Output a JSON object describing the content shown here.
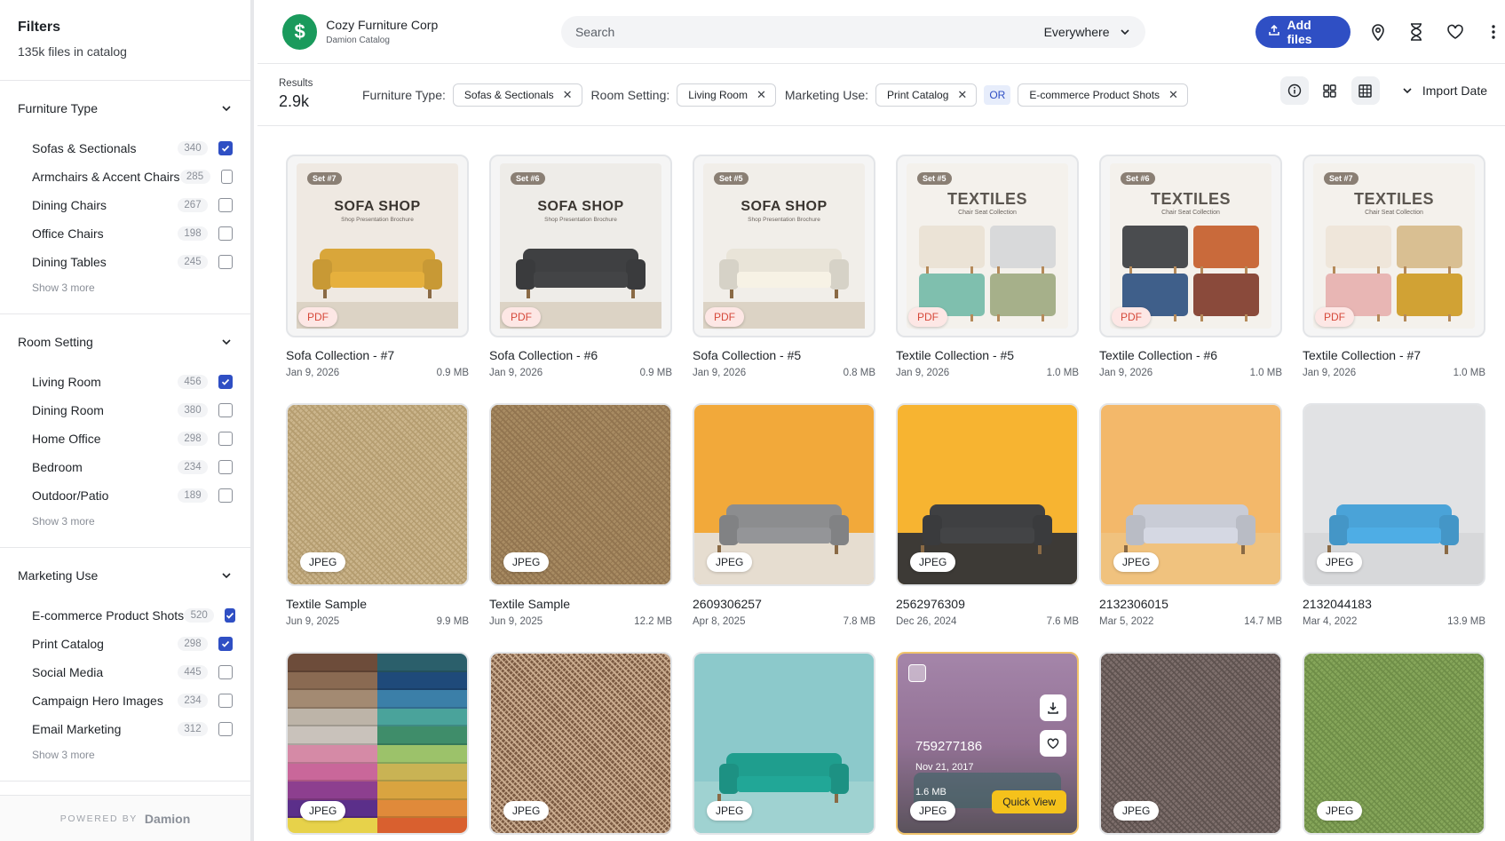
{
  "sidebar": {
    "title": "Filters",
    "subtitle": "135k files in catalog",
    "groups": [
      {
        "title": "Furniture Type",
        "show_more": "Show 3 more",
        "items": [
          {
            "label": "Sofas & Sectionals",
            "count": "340",
            "checked": true
          },
          {
            "label": "Armchairs & Accent Chairs",
            "count": "285",
            "checked": false
          },
          {
            "label": "Dining Chairs",
            "count": "267",
            "checked": false
          },
          {
            "label": "Office Chairs",
            "count": "198",
            "checked": false
          },
          {
            "label": "Dining Tables",
            "count": "245",
            "checked": false
          }
        ]
      },
      {
        "title": "Room Setting",
        "show_more": "Show 3 more",
        "items": [
          {
            "label": "Living Room",
            "count": "456",
            "checked": true
          },
          {
            "label": "Dining Room",
            "count": "380",
            "checked": false
          },
          {
            "label": "Home Office",
            "count": "298",
            "checked": false
          },
          {
            "label": "Bedroom",
            "count": "234",
            "checked": false
          },
          {
            "label": "Outdoor/Patio",
            "count": "189",
            "checked": false
          }
        ]
      },
      {
        "title": "Marketing Use",
        "show_more": "Show 3 more",
        "items": [
          {
            "label": "E-commerce Product Shots",
            "count": "520",
            "checked": true
          },
          {
            "label": "Print Catalog",
            "count": "298",
            "checked": true
          },
          {
            "label": "Social Media",
            "count": "445",
            "checked": false
          },
          {
            "label": "Campaign Hero Images",
            "count": "234",
            "checked": false
          },
          {
            "label": "Email Marketing",
            "count": "312",
            "checked": false
          }
        ]
      }
    ],
    "powered_by": "POWERED BY",
    "powered_brand": "Damion"
  },
  "topbar": {
    "org_name": "Cozy Furniture Corp",
    "org_sub": "Damion Catalog",
    "search_placeholder": "Search",
    "scope": "Everywhere",
    "add_files": "Add files"
  },
  "filterbar": {
    "results_label": "Results",
    "results_value": "2.9k",
    "furniture_label": "Furniture Type:",
    "furniture_chip": "Sofas & Sectionals",
    "room_label": "Room Setting:",
    "room_chip": "Living Room",
    "marketing_label": "Marketing Use:",
    "marketing_chip_1": "Print Catalog",
    "or_label": "OR",
    "marketing_chip_2": "E-commerce Product Shots",
    "sort_label": "Import Date"
  },
  "cards": [
    {
      "title": "Sofa Collection - #7",
      "date": "Jan 9, 2026",
      "size": "0.9 MB",
      "type": "PDF",
      "set": "Set #7",
      "poster": "SOFA SHOP",
      "poster_sub": "Shop Presentation Brochure",
      "kind": "sofa",
      "sofa": "#d9a63a",
      "bg": "#efe9e2"
    },
    {
      "title": "Sofa Collection - #6",
      "date": "Jan 9, 2026",
      "size": "0.9 MB",
      "type": "PDF",
      "set": "Set #6",
      "poster": "SOFA SHOP",
      "poster_sub": "Shop Presentation Brochure",
      "kind": "sofa",
      "sofa": "#3f4042",
      "bg": "#eeece8"
    },
    {
      "title": "Sofa Collection - #5",
      "date": "Jan 9, 2026",
      "size": "0.8 MB",
      "type": "PDF",
      "set": "Set #5",
      "poster": "SOFA SHOP",
      "poster_sub": "Shop Presentation Brochure",
      "kind": "sofa",
      "sofa": "#e9e4d8",
      "bg": "#f1eee9"
    },
    {
      "title": "Textile Collection - #5",
      "date": "Jan 9, 2026",
      "size": "1.0 MB",
      "type": "PDF",
      "set": "Set #5",
      "poster": "TEXTILES",
      "poster_sub": "Chair Seat Collection",
      "kind": "tex",
      "swatches": [
        "#ebe3d6",
        "#d8d9da",
        "#7fbfae",
        "#a6b08a"
      ]
    },
    {
      "title": "Textile Collection - #6",
      "date": "Jan 9, 2026",
      "size": "1.0 MB",
      "type": "PDF",
      "set": "Set #6",
      "poster": "TEXTILES",
      "poster_sub": "Chair Seat Collection",
      "kind": "tex",
      "swatches": [
        "#4a4c4f",
        "#c96a3b",
        "#3f5f8a",
        "#8a4a3b"
      ]
    },
    {
      "title": "Textile Collection - #7",
      "date": "Jan 9, 2026",
      "size": "1.0 MB",
      "type": "PDF",
      "set": "Set #7",
      "poster": "TEXTILES",
      "poster_sub": "Chair Seat Collection",
      "kind": "tex",
      "swatches": [
        "#efe6da",
        "#d9bf92",
        "#e8b6b4",
        "#d1a234"
      ]
    },
    {
      "title": "Textile Sample",
      "date": "Jun 9, 2025",
      "size": "9.9 MB",
      "type": "JPEG",
      "kind": "fabric",
      "bg": "#cbb58c",
      "stripe": "#b59d70"
    },
    {
      "title": "Textile Sample",
      "date": "Jun 9, 2025",
      "size": "12.2 MB",
      "type": "JPEG",
      "kind": "fabric",
      "bg": "#a88b62",
      "stripe": "#927550"
    },
    {
      "title": "2609306257",
      "date": "Apr 8, 2025",
      "size": "7.8 MB",
      "type": "JPEG",
      "kind": "room",
      "bg": "#f2a93a",
      "floor": "#e6ddd0",
      "sofa": "#8c8d8f"
    },
    {
      "title": "2562976309",
      "date": "Dec 26, 2024",
      "size": "7.6 MB",
      "type": "JPEG",
      "kind": "room",
      "bg": "#f7b431",
      "floor": "#3d3a36",
      "sofa": "#3f4042"
    },
    {
      "title": "2132306015",
      "date": "Mar 5, 2022",
      "size": "14.7 MB",
      "type": "JPEG",
      "kind": "room",
      "bg": "#f3b86a",
      "floor": "#f0c27e",
      "sofa": "#c9ccd6"
    },
    {
      "title": "2132044183",
      "date": "Mar 4, 2022",
      "size": "13.9 MB",
      "type": "JPEG",
      "kind": "room",
      "bg": "#e1e2e4",
      "floor": "#d7d8da",
      "sofa": "#4aa3d8"
    },
    {
      "title": "",
      "date": "",
      "size": "",
      "type": "JPEG",
      "kind": "stack"
    },
    {
      "title": "",
      "date": "",
      "size": "",
      "type": "JPEG",
      "kind": "fabric",
      "bg": "#7b5a42",
      "stripe": "#c9ab8e"
    },
    {
      "title": "",
      "date": "",
      "size": "",
      "type": "JPEG",
      "kind": "room",
      "bg": "#8cc9cb",
      "floor": "#9fd2d1",
      "sofa": "#1f9e8e"
    },
    {
      "title": "",
      "date": "",
      "size": "",
      "type": "JPEG",
      "kind": "hover",
      "bg": "#c4a0c8",
      "id": "759277186",
      "hdate": "Nov 21, 2017",
      "hsize": "1.6 MB",
      "quick": "Quick View"
    },
    {
      "title": "",
      "date": "",
      "size": "",
      "type": "JPEG",
      "kind": "fabric",
      "bg": "#7e6f6c",
      "stripe": "#5f5350"
    },
    {
      "title": "",
      "date": "",
      "size": "",
      "type": "JPEG",
      "kind": "fabric",
      "bg": "#86a65a",
      "stripe": "#6f8e48"
    }
  ],
  "colors": {
    "accent": "#2f4fc4",
    "brand": "#1a9a5c",
    "pdf": "#d6493a",
    "quick": "#f5c21b"
  }
}
